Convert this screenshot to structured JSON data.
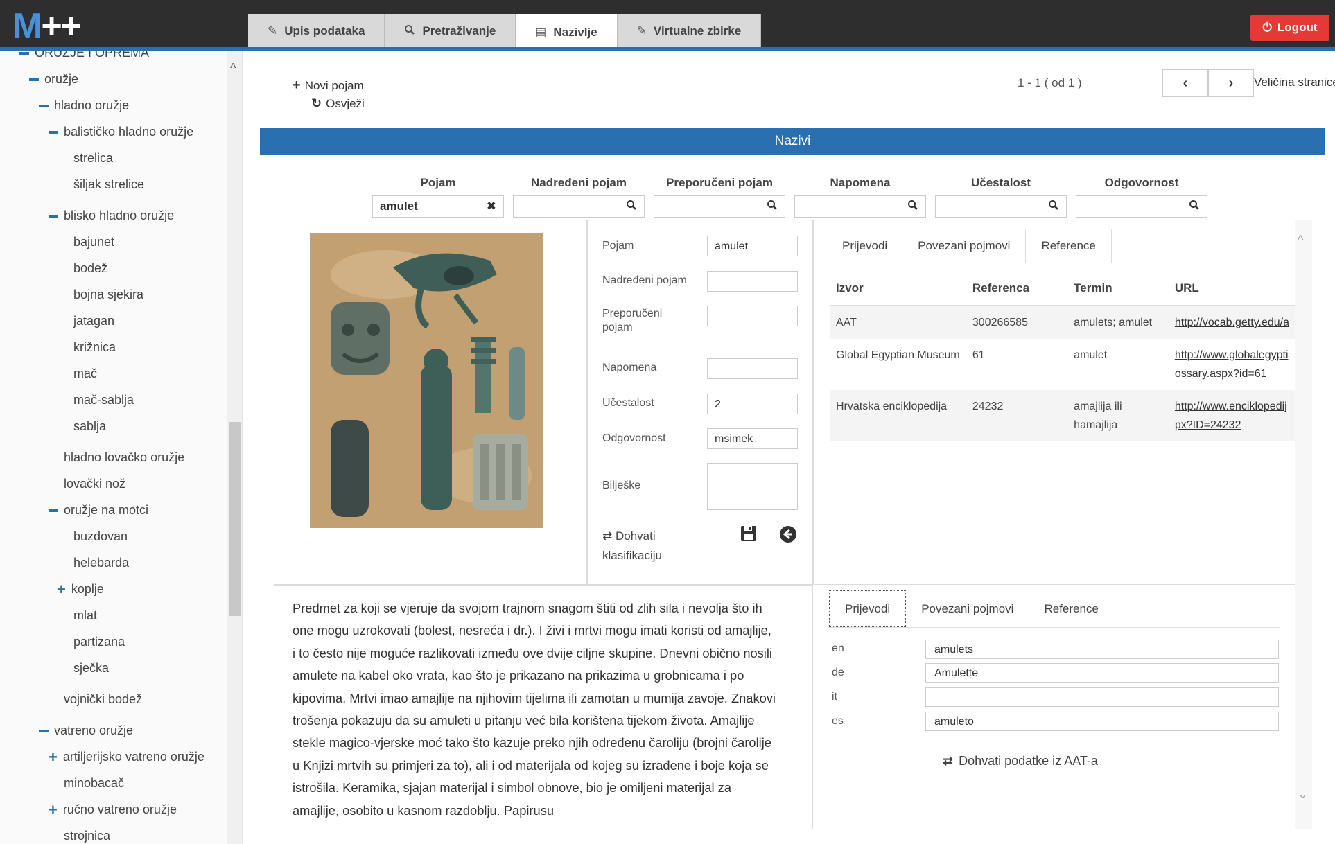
{
  "app": {
    "logo_main": "M",
    "logo_suffix": "++"
  },
  "tabs": [
    {
      "label": "Upis podataka",
      "icon": "edit-icon"
    },
    {
      "label": "Pretraživanje",
      "icon": "search-icon"
    },
    {
      "label": "Nazivlje",
      "icon": "list-icon",
      "active": true
    },
    {
      "label": "Virtualne zbirke",
      "icon": "edit-icon"
    }
  ],
  "logout_label": "Logout",
  "tree": [
    {
      "label": "ORUŽJE I OPREMA",
      "state": "expanded",
      "level": 0
    },
    {
      "label": "oružje",
      "state": "expanded",
      "level": 1
    },
    {
      "label": "hladno oružje",
      "state": "expanded",
      "level": 2
    },
    {
      "label": "balističko hladno oružje",
      "state": "expanded",
      "level": 3
    },
    {
      "label": "strelica",
      "state": "leaf",
      "level": 4
    },
    {
      "label": "šiljak strelice",
      "state": "leaf",
      "level": 4
    },
    {
      "label": "blisko hladno oružje",
      "state": "expanded",
      "level": 3
    },
    {
      "label": "bajunet",
      "state": "leaf",
      "level": 4
    },
    {
      "label": "bodež",
      "state": "leaf",
      "level": 4
    },
    {
      "label": "bojna sjekira",
      "state": "leaf",
      "level": 4
    },
    {
      "label": "jatagan",
      "state": "leaf",
      "level": 4
    },
    {
      "label": "križnica",
      "state": "leaf",
      "level": 4
    },
    {
      "label": "mač",
      "state": "leaf",
      "level": 4
    },
    {
      "label": "mač-sablja",
      "state": "leaf",
      "level": 4
    },
    {
      "label": "sablja",
      "state": "leaf",
      "level": 4
    },
    {
      "label": "hladno lovačko oružje",
      "state": "leaf",
      "level": 3
    },
    {
      "label": "lovački nož",
      "state": "leaf",
      "level": 3
    },
    {
      "label": "oružje na motci",
      "state": "expanded",
      "level": 3
    },
    {
      "label": "buzdovan",
      "state": "leaf",
      "level": 4
    },
    {
      "label": "helebarda",
      "state": "leaf",
      "level": 4
    },
    {
      "label": "koplje",
      "state": "collapsed",
      "level": 4
    },
    {
      "label": "mlat",
      "state": "leaf",
      "level": 4
    },
    {
      "label": "partizana",
      "state": "leaf",
      "level": 4
    },
    {
      "label": "sječka",
      "state": "leaf",
      "level": 4
    },
    {
      "label": "vojnički bodež",
      "state": "leaf",
      "level": 3
    },
    {
      "label": "vatreno oružje",
      "state": "expanded",
      "level": 2
    },
    {
      "label": "artiljerijsko vatreno oružje",
      "state": "collapsed",
      "level": 3
    },
    {
      "label": "minobacač",
      "state": "leaf",
      "level": 3
    },
    {
      "label": "ručno vatreno oružje",
      "state": "collapsed",
      "level": 3
    },
    {
      "label": "strojnica",
      "state": "leaf",
      "level": 3
    }
  ],
  "toolbar": {
    "new_term": "Novi pojam",
    "refresh": "Osvježi"
  },
  "pager": {
    "text": "1 - 1 ( od 1 )",
    "page_size_label": "Veličina stranice"
  },
  "section_title": "Nazivi",
  "filters": [
    {
      "label": "Pojam",
      "value": "amulet",
      "icon": "clear-icon"
    },
    {
      "label": "Nadređeni pojam",
      "value": "",
      "icon": "search-icon"
    },
    {
      "label": "Preporučeni pojam",
      "value": "",
      "icon": "search-icon"
    },
    {
      "label": "Napomena",
      "value": "",
      "icon": "search-icon"
    },
    {
      "label": "Učestalost",
      "value": "",
      "icon": "search-icon"
    },
    {
      "label": "Odgovornost",
      "value": "",
      "icon": "search-icon"
    }
  ],
  "form": {
    "pojam_label": "Pojam",
    "pojam_value": "amulet",
    "nadredjeni_label": "Nadređeni pojam",
    "nadredjeni_value": "",
    "preporuceni_label_1": "Preporučeni",
    "preporuceni_label_2": "pojam",
    "preporuceni_value": "",
    "napomena_label": "Napomena",
    "napomena_value": "",
    "ucestalost_label": "Učestalost",
    "ucestalost_value": "2",
    "odgovornost_label": "Odgovornost",
    "odgovornost_value": "msimek",
    "biljeske_label": "Bilješke",
    "biljeske_value": "",
    "dohvati_1": "Dohvati",
    "dohvati_2": "klasifikaciju"
  },
  "top_subtabs": [
    {
      "label": "Prijevodi"
    },
    {
      "label": "Povezani pojmovi"
    },
    {
      "label": "Reference",
      "active": true
    }
  ],
  "references": {
    "headers": [
      "Izvor",
      "Referenca",
      "Termin",
      "URL"
    ],
    "rows": [
      {
        "izvor": "AAT",
        "referenca": "300266585",
        "termin": "amulets; amulet",
        "url_1": "http://vocab.getty.edu/a",
        "url_2": ""
      },
      {
        "izvor": "Global Egyptian Museum",
        "referenca": "61",
        "termin": "amulet",
        "url_1": "http://www.globalegypti",
        "url_2": "ossary.aspx?id=61"
      },
      {
        "izvor": "Hrvatska enciklopedija",
        "referenca": "24232",
        "termin": "amajlija ili hamajlija",
        "url_1": "http://www.enciklopedij",
        "url_2": "px?ID=24232"
      }
    ]
  },
  "description": "Predmet za koji se vjeruje da svojom trajnom snagom štiti od zlih sila i nevolja što ih one mogu uzrokovati (bolest, nesreća i dr.). I živi i mrtvi mogu imati koristi od amajlije, i to često nije moguće razlikovati između ove dvije ciljne skupine. Dnevni obično nosili amulete na kabel oko vrata, kao što je prikazano na prikazima u grobnicama i po kipovima. Mrtvi imao amajlije na njihovim tijelima ili zamotan u mumija zavoje. Znakovi trošenja pokazuju da su amuleti u pitanju već bila korištena tijekom života. Amajlije stekle magico-vjerske moć tako što kazuje preko njih određenu čaroliju (brojni čarolije u Knjizi mrtvih su primjeri za to), ali i od materijala od kojeg su izrađene i boje koja se istrošila. Keramika, sjajan materijal i simbol obnove, bio je omiljeni materijal za amajlije, osobito u kasnom razdoblju. Papirusu",
  "bottom_subtabs": [
    {
      "label": "Prijevodi",
      "active": true
    },
    {
      "label": "Povezani pojmovi"
    },
    {
      "label": "Reference"
    }
  ],
  "translations": [
    {
      "lang": "en",
      "value": "amulets"
    },
    {
      "lang": "de",
      "value": "Amulette"
    },
    {
      "lang": "it",
      "value": ""
    },
    {
      "lang": "es",
      "value": "amuleto"
    }
  ],
  "aat_button": "Dohvati podatke iz AAT-a",
  "colors": {
    "accent": "#2a6fb0",
    "logout": "#e53935",
    "topbar": "#2e2e2e"
  }
}
